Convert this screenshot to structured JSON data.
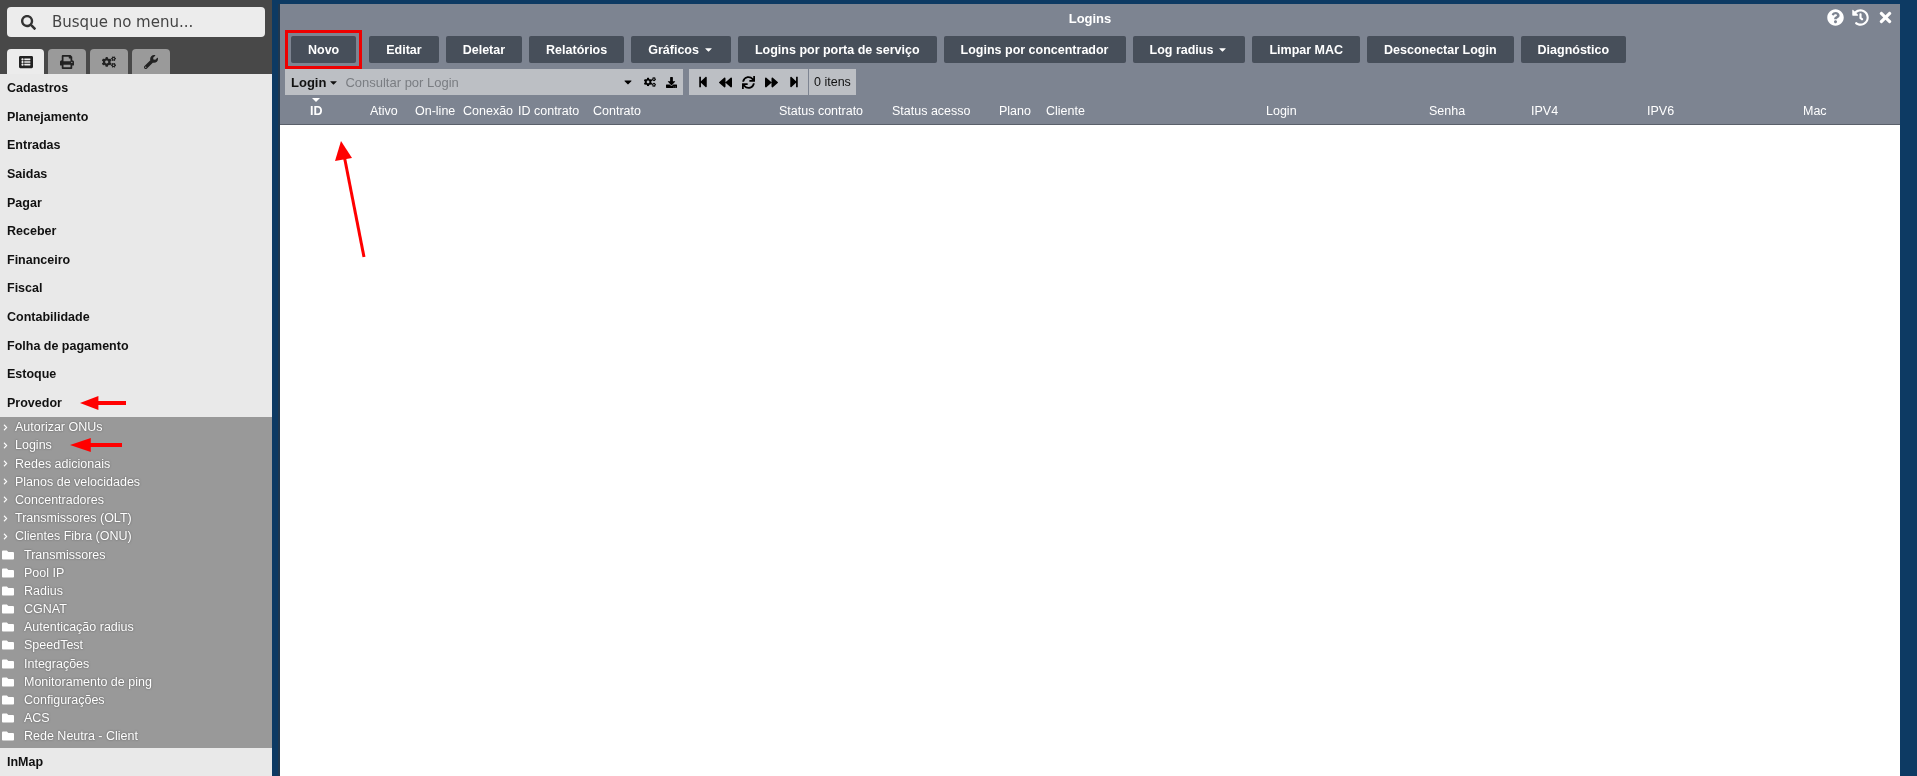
{
  "sidebar": {
    "search": {
      "placeholder": "Busque no menu..."
    },
    "tabs": [
      {
        "selected": true
      },
      {
        "selected": false
      },
      {
        "selected": false
      },
      {
        "selected": false
      }
    ],
    "items": [
      {
        "label": "Cadastros",
        "annotated": false
      },
      {
        "label": "Planejamento",
        "annotated": false
      },
      {
        "label": "Entradas",
        "annotated": false
      },
      {
        "label": "Saidas",
        "annotated": false
      },
      {
        "label": "Pagar",
        "annotated": false
      },
      {
        "label": "Receber",
        "annotated": false
      },
      {
        "label": "Financeiro",
        "annotated": false
      },
      {
        "label": "Fiscal",
        "annotated": false
      },
      {
        "label": "Contabilidade",
        "annotated": false
      },
      {
        "label": "Folha de pagamento",
        "annotated": false
      },
      {
        "label": "Estoque",
        "annotated": false
      },
      {
        "label": "Provedor",
        "annotated": true,
        "children": [
          {
            "label": "Autorizar ONUs",
            "kind": "link",
            "annotated": false
          },
          {
            "label": "Logins",
            "kind": "link",
            "annotated": true
          },
          {
            "label": "Redes adicionais",
            "kind": "link",
            "annotated": false
          },
          {
            "label": "Planos de velocidades",
            "kind": "link",
            "annotated": false
          },
          {
            "label": "Concentradores",
            "kind": "link",
            "annotated": false
          },
          {
            "label": "Transmissores (OLT)",
            "kind": "link",
            "annotated": false
          },
          {
            "label": "Clientes Fibra (ONU)",
            "kind": "link",
            "annotated": false
          },
          {
            "label": "Transmissores",
            "kind": "folder",
            "annotated": false
          },
          {
            "label": "Pool IP",
            "kind": "folder",
            "annotated": false
          },
          {
            "label": "Radius",
            "kind": "folder",
            "annotated": false
          },
          {
            "label": "CGNAT",
            "kind": "folder",
            "annotated": false
          },
          {
            "label": "Autenticação radius",
            "kind": "folder",
            "annotated": false
          },
          {
            "label": "SpeedTest",
            "kind": "folder",
            "annotated": false
          },
          {
            "label": "Integrações",
            "kind": "folder",
            "annotated": false
          },
          {
            "label": "Monitoramento de ping",
            "kind": "folder",
            "annotated": false
          },
          {
            "label": "Configurações",
            "kind": "folder",
            "annotated": false
          },
          {
            "label": "ACS",
            "kind": "folder",
            "annotated": false
          },
          {
            "label": "Rede Neutra - Client",
            "kind": "folder",
            "annotated": false
          }
        ]
      },
      {
        "label": "InMap",
        "annotated": false
      }
    ]
  },
  "window": {
    "title": "Logins",
    "toolbar": [
      {
        "label": "Novo",
        "dropdown": false,
        "highlighted": true
      },
      {
        "label": "Editar",
        "dropdown": false,
        "highlighted": false
      },
      {
        "label": "Deletar",
        "dropdown": false,
        "highlighted": false
      },
      {
        "label": "Relatórios",
        "dropdown": false,
        "highlighted": false
      },
      {
        "label": "Gráficos",
        "dropdown": true,
        "highlighted": false
      },
      {
        "label": "Logins por porta de serviço",
        "dropdown": false,
        "highlighted": false
      },
      {
        "label": "Logins por concentrador",
        "dropdown": false,
        "highlighted": false
      },
      {
        "label": "Log radius",
        "dropdown": true,
        "highlighted": false
      },
      {
        "label": "Limpar MAC",
        "dropdown": false,
        "highlighted": false
      },
      {
        "label": "Desconectar Login",
        "dropdown": false,
        "highlighted": false
      },
      {
        "label": "Diagnóstico",
        "dropdown": false,
        "highlighted": false
      }
    ],
    "filter": {
      "field": "Login",
      "placeholder": "Consultar por Login"
    },
    "item_count": "0 itens",
    "table": {
      "annotated": true,
      "columns": [
        {
          "label": "ID",
          "sorted": true
        },
        {
          "label": "Ativo",
          "sorted": false
        },
        {
          "label": "On-line",
          "sorted": false
        },
        {
          "label": "Conexão",
          "sorted": false
        },
        {
          "label": "ID contrato",
          "sorted": false
        },
        {
          "label": "Contrato",
          "sorted": false
        },
        {
          "label": "Status contrato",
          "sorted": false
        },
        {
          "label": "Status acesso",
          "sorted": false
        },
        {
          "label": "Plano",
          "sorted": false
        },
        {
          "label": "Cliente",
          "sorted": false
        },
        {
          "label": "Login",
          "sorted": false
        },
        {
          "label": "Senha",
          "sorted": false
        },
        {
          "label": "IPV4",
          "sorted": false
        },
        {
          "label": "IPV6",
          "sorted": false
        },
        {
          "label": "Mac",
          "sorted": false
        }
      ]
    }
  }
}
